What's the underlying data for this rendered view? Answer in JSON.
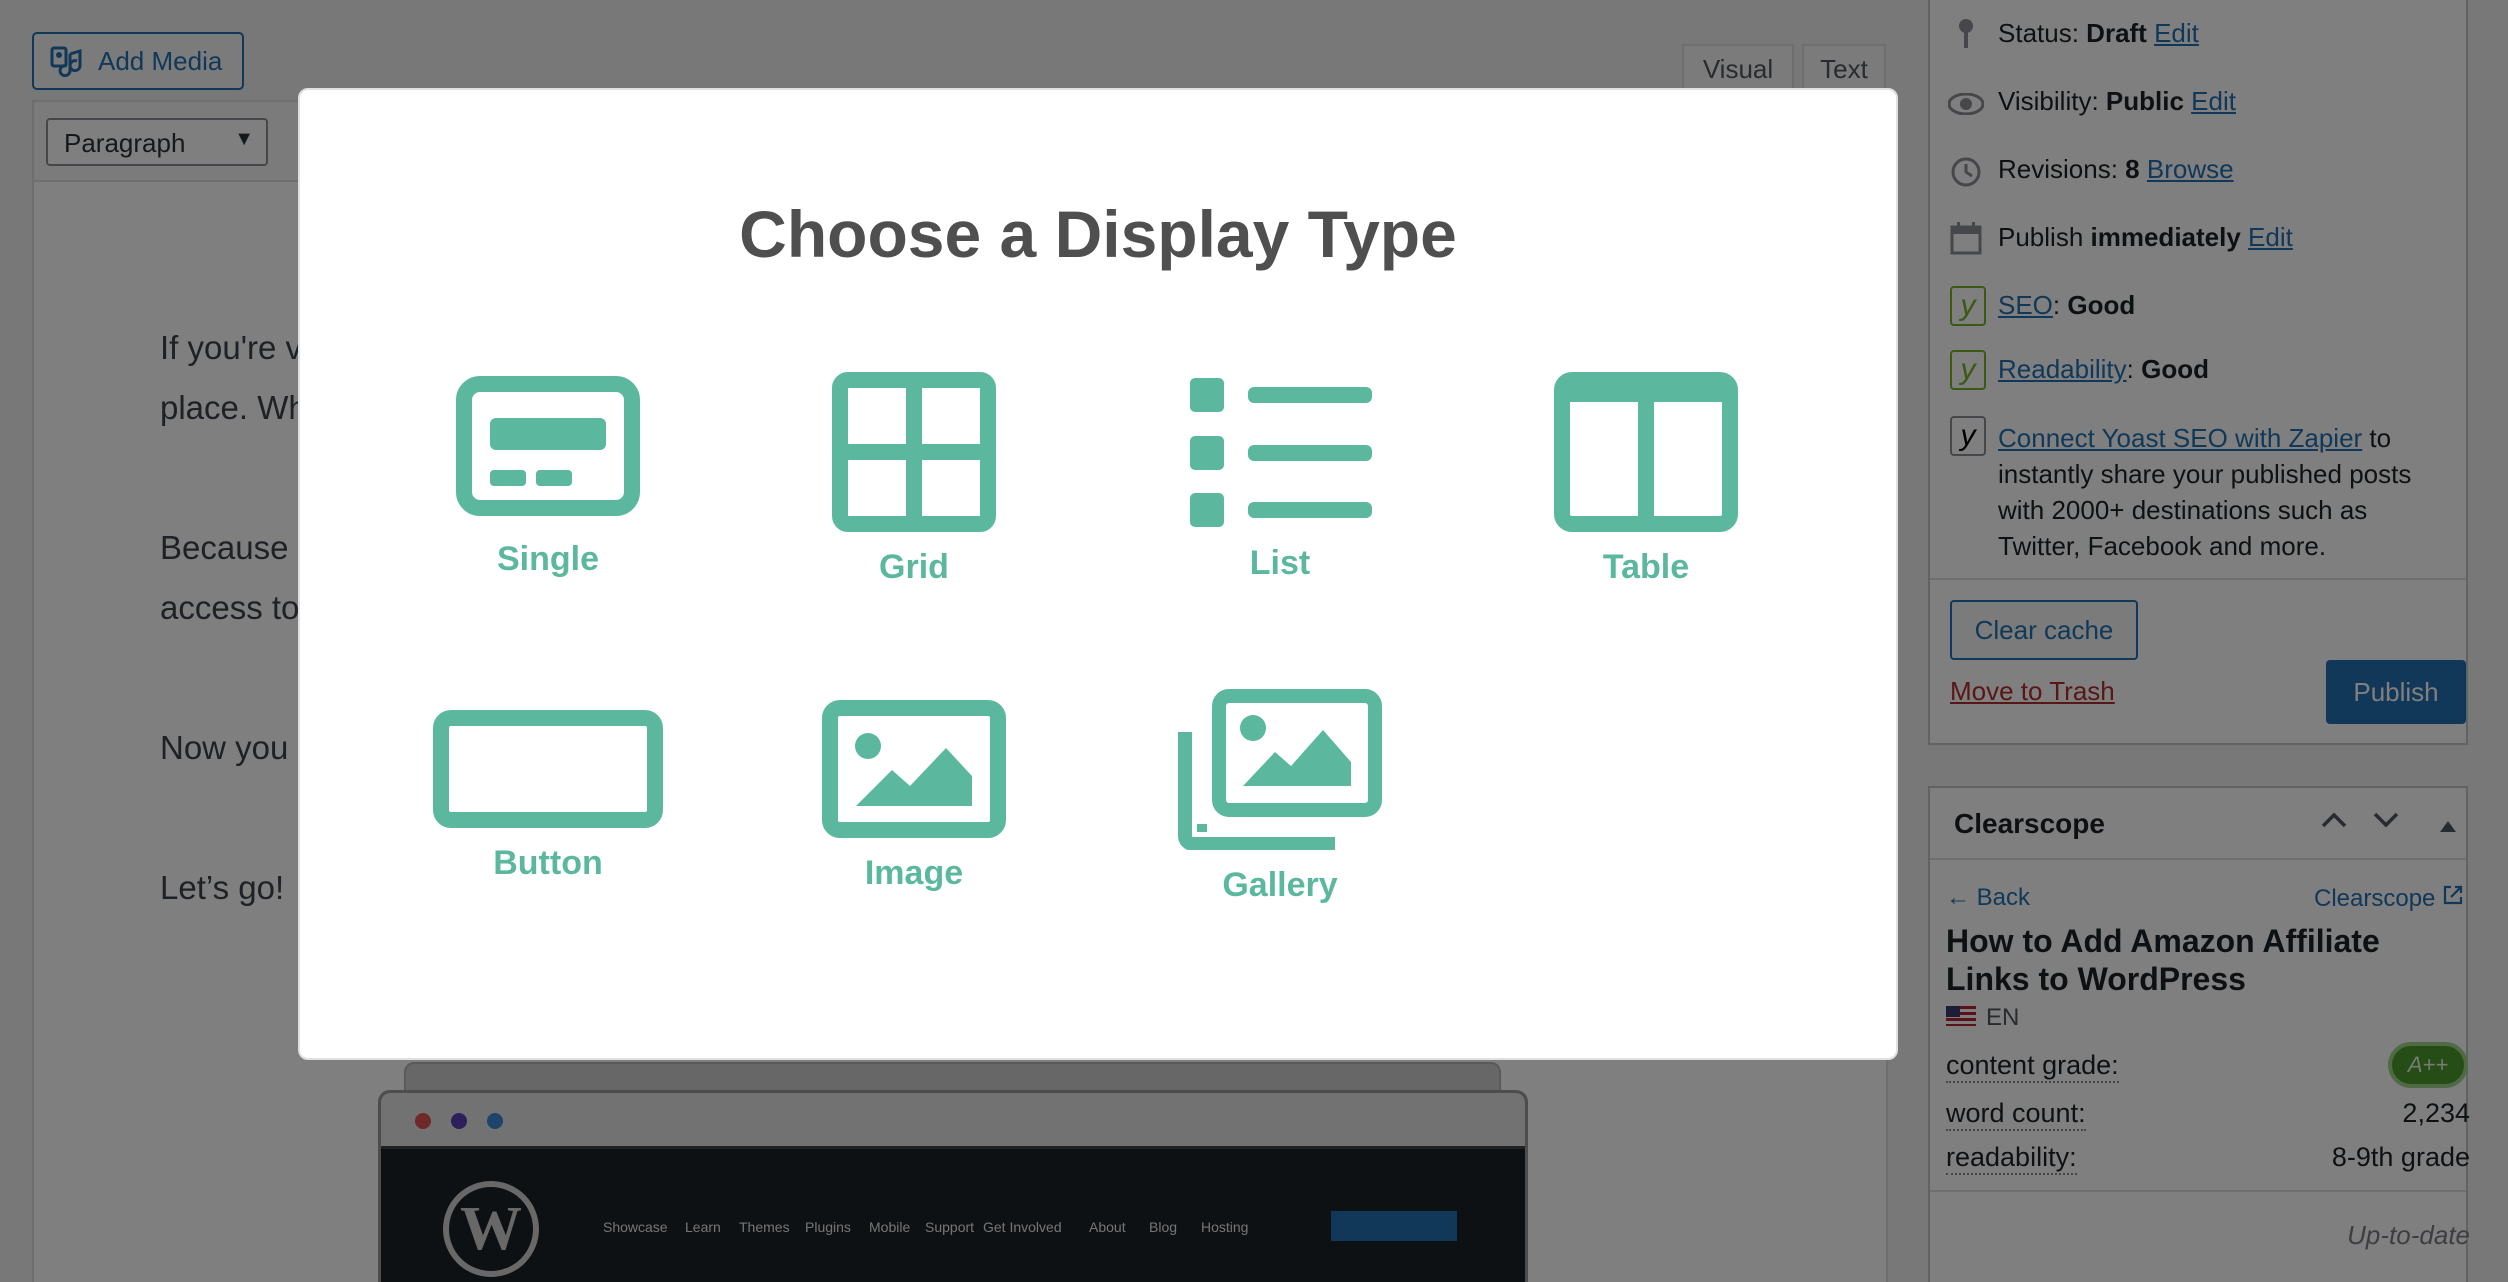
{
  "editor": {
    "add_media": "Add Media",
    "tabs": {
      "visual": "Visual",
      "text": "Text"
    },
    "format_select": "Paragraph",
    "paragraphs": [
      {
        "line1": "If you're v",
        "line2": "place. Wh"
      },
      {
        "line1": "Because",
        "line2": "access to"
      },
      {
        "line1": "Now you"
      },
      {
        "line1": "Let’s go!"
      }
    ],
    "browser_mock": {
      "nav": [
        "Showcase",
        "Learn",
        "Themes",
        "Plugins",
        "Mobile",
        "Support",
        "Get Involved",
        "About",
        "Blog",
        "Hosting"
      ],
      "dot_colors": [
        "#e05252",
        "#5b3fb3",
        "#3b8ad8"
      ]
    }
  },
  "publish": {
    "status_label": "Status:",
    "status_value": "Draft",
    "status_edit": "Edit",
    "visibility_label": "Visibility:",
    "visibility_value": "Public",
    "visibility_edit": "Edit",
    "revisions_label": "Revisions:",
    "revisions_value": "8",
    "revisions_link": "Browse",
    "publish_label": "Publish",
    "publish_when": "immediately",
    "publish_edit": "Edit",
    "seo_link": "SEO",
    "seo_value": "Good",
    "readability_link": "Readability",
    "readability_value": "Good",
    "zapier_link": "Connect Yoast SEO with Zapier",
    "zapier_text": [
      " to",
      "instantly share your published posts",
      "with 2000+ destinations such as",
      "Twitter, Facebook and more."
    ],
    "clear_cache": "Clear cache",
    "trash": "Move to Trash",
    "publish_button": "Publish"
  },
  "clearscope": {
    "title": "Clearscope",
    "back": "Back",
    "brand_link": "Clearscope",
    "headline": "How to Add Amazon Affiliate Links to WordPress",
    "lang": "EN",
    "grade_label": "content grade:",
    "grade_value": "A++",
    "word_label": "word count:",
    "word_value": "2,234",
    "read_label": "readability:",
    "read_value": "8-9th grade",
    "status": "Up-to-date"
  },
  "modal": {
    "title": "Choose a Display Type",
    "accent": "#5bb89f",
    "options": [
      "Single",
      "Grid",
      "List",
      "Table",
      "Button",
      "Image",
      "Gallery"
    ]
  }
}
